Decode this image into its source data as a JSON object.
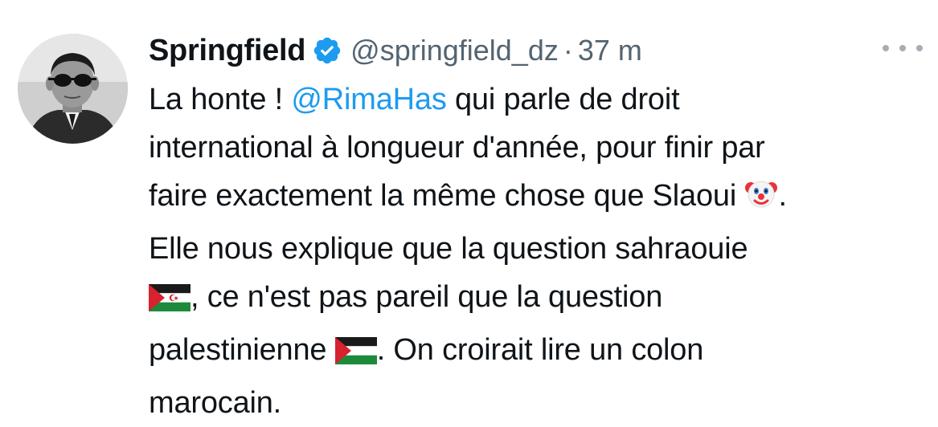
{
  "tweet": {
    "author": {
      "display_name": "Springfield",
      "handle": "@springfield_dz",
      "verified": true,
      "verified_icon": "verified-badge-icon"
    },
    "separator": "·",
    "time": "37 m",
    "more_icon": "more-options-icon",
    "body": {
      "line1_pre": "La honte ! ",
      "mention": "@RimaHas",
      "line1_post": " qui parle de droit",
      "line2": "international à longueur d'année, pour finir par",
      "line3": "faire exactement la même chose que Slaoui ",
      "line3_emoji": "clown-face-emoji",
      "line3_end": ".",
      "line4": "Elle nous explique que la question sahraouie",
      "line5_emoji": "western-sahara-flag-emoji",
      "line5": ", ce n'est pas pareil que la question",
      "line6": "palestinienne ",
      "line6_emoji": "palestine-flag-emoji",
      "line6_end": ". On croirait lire un colon",
      "line7": "marocain."
    }
  },
  "colors": {
    "text": "#0f1419",
    "secondary": "#536471",
    "link": "#1d9bf0",
    "verified": "#1d9bf0"
  }
}
